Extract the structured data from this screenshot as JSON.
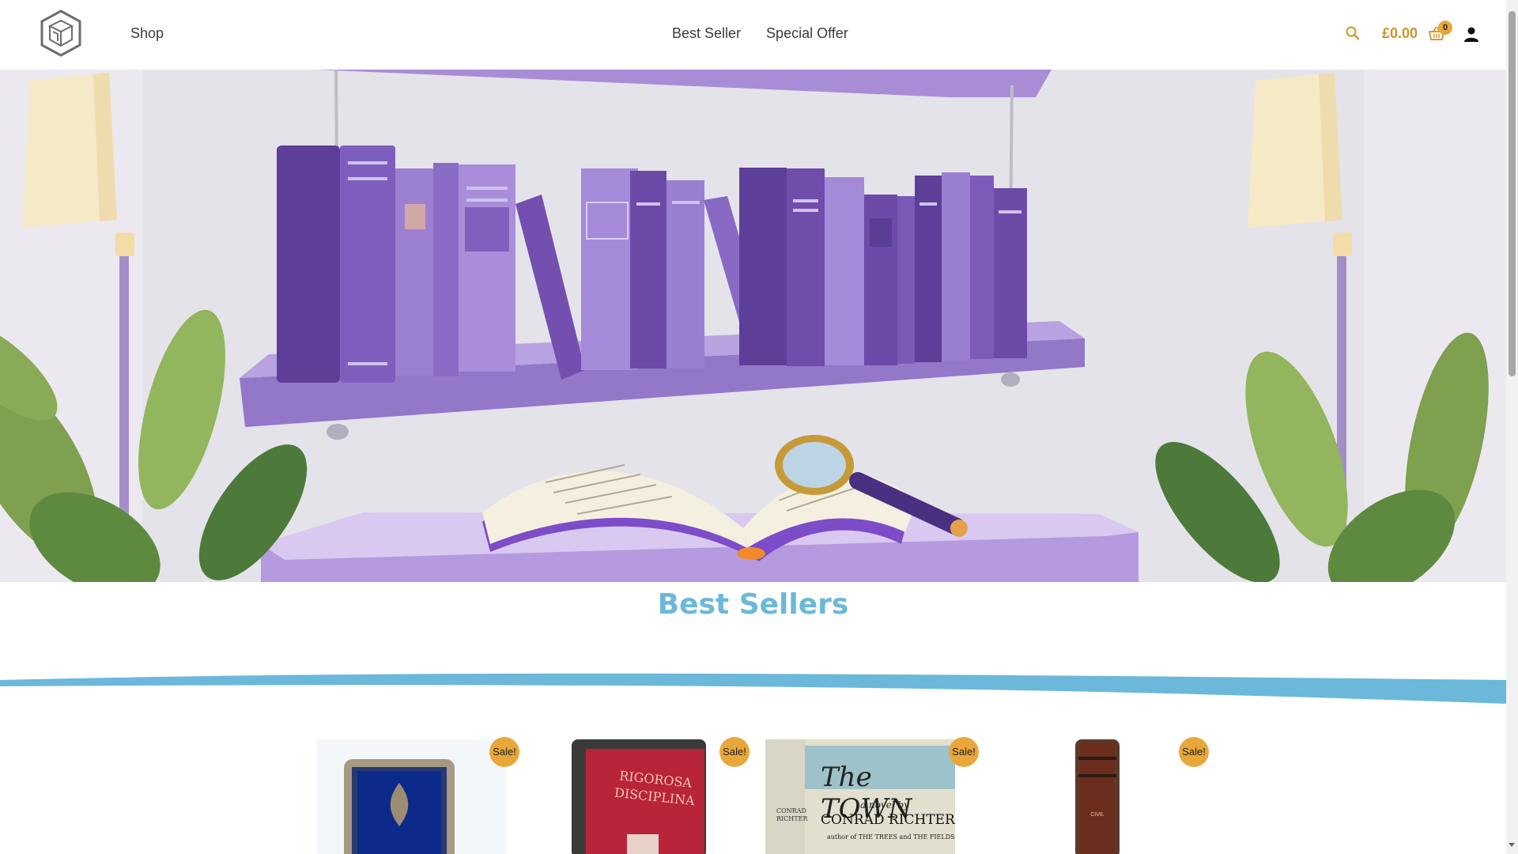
{
  "header": {
    "logo_icon": "cube-logo-icon",
    "nav_shop": "Shop",
    "nav_center": [
      {
        "label": "Best Seller"
      },
      {
        "label": "Special Offer"
      }
    ],
    "search_icon": "search-icon",
    "cart_total": "£0.00",
    "cart_count": "0",
    "cart_icon": "basket-icon",
    "account_icon": "user-icon",
    "accent_color": "#c8952f"
  },
  "hero": {
    "description_icon": "bookshelf-illustration"
  },
  "section": {
    "title": "Best Sellers",
    "title_color": "#6bb8db",
    "wave_color": "#6bb8db"
  },
  "products": [
    {
      "badge": "Sale!",
      "cover_title": ""
    },
    {
      "badge": "Sale!",
      "cover_title": "RIGOROSA DISCIPLINA"
    },
    {
      "badge": "Sale!",
      "cover_title": "The TOWN",
      "cover_subtitle": "a novel by",
      "cover_author": "CONRAD RICHTER",
      "cover_tagline": "author of THE TREES and THE FIELDS",
      "cover_spine": "CONRAD RICHTER"
    },
    {
      "badge": "Sale!",
      "cover_title": "CIVIL"
    }
  ],
  "badge_color": "#e8a73a"
}
